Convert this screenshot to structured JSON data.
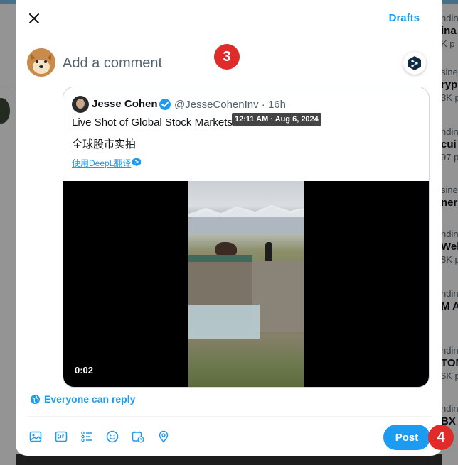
{
  "background": {
    "trends": [
      {
        "meta": "ndin",
        "title": "ina",
        "count": "K p"
      },
      {
        "meta": "sine",
        "title": "ryp",
        "count": "8K p"
      },
      {
        "meta": "ndin",
        "title": "cui",
        "count": "97 p"
      },
      {
        "meta": "sine",
        "title": "nero",
        "count": ""
      },
      {
        "meta": "ndin",
        "title": "Web",
        "count": "8K p"
      },
      {
        "meta": "ndin",
        "title": "M AI",
        "count": ""
      },
      {
        "meta": "ndin",
        "title": "TON",
        "count": "6K p"
      },
      {
        "meta": "ndin",
        "title": "BX",
        "count": ""
      }
    ]
  },
  "modal": {
    "drafts_label": "Drafts",
    "composer_placeholder": "Add a comment",
    "quote": {
      "author_name": "Jesse Cohen",
      "author_handle_time": "@JesseCohenInv · 16h",
      "text_line1": "Live Shot of Global Stock Markets",
      "text_line2": "全球股市实拍",
      "translate_link": "使用DeepL翻译",
      "tooltip": "12:11 AM · Aug 6, 2024",
      "video_timecode": "0:02"
    },
    "reply_setting_label": "Everyone can reply",
    "post_label": "Post"
  },
  "annotations": {
    "badge_3": "3",
    "badge_4": "4"
  },
  "colors": {
    "accent": "#1d9bf0",
    "badge": "#e02b2b",
    "verified": "#1d9bf0"
  },
  "icons": [
    "close-icon",
    "deepl-icon",
    "verified-badge-icon",
    "globe-icon",
    "image-icon",
    "gif-icon",
    "poll-icon",
    "emoji-icon",
    "schedule-icon",
    "location-icon"
  ]
}
